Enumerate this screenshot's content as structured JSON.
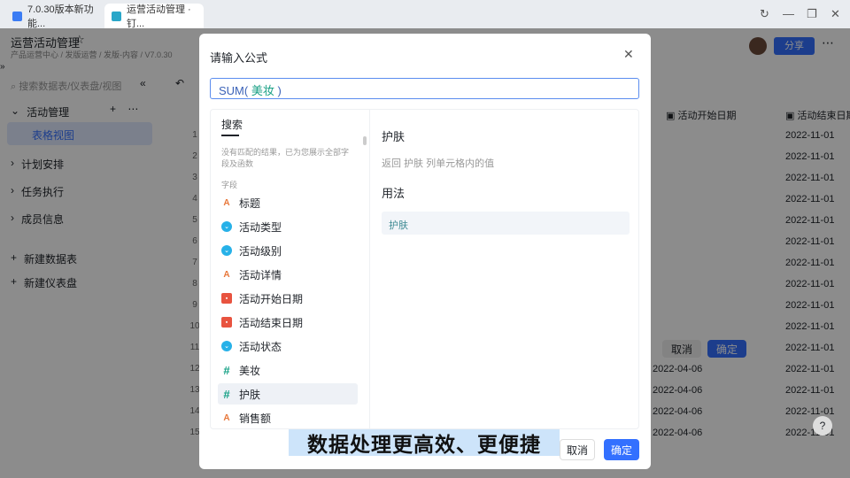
{
  "browser": {
    "tabs": [
      {
        "label": "7.0.30版本新功能..."
      },
      {
        "label": "运营活动管理 · 钉..."
      }
    ]
  },
  "header": {
    "title": "运营活动管理",
    "breadcrumb": "产品运营中心 / 发版运营 / 发版-内容 / V7.0.30",
    "share": "分享"
  },
  "sidebar": {
    "search_placeholder": "搜索数据表/仪表盘/视图",
    "items": [
      {
        "label": "活动管理"
      },
      {
        "label": "表格视图"
      },
      {
        "label": "计划安排"
      },
      {
        "label": "任务执行"
      },
      {
        "label": "成员信息"
      },
      {
        "label": "新建数据表"
      },
      {
        "label": "新建仪表盘"
      }
    ]
  },
  "table": {
    "columns": [
      "活动开始日期",
      "活动结束日期"
    ],
    "row_numbers": [
      "1",
      "2",
      "3",
      "4",
      "5",
      "6",
      "7",
      "8",
      "9",
      "10",
      "11",
      "12",
      "13",
      "14",
      "15"
    ],
    "start_dates": [
      "2022-04-06",
      "2022-04-06",
      "2022-04-06",
      "2022-04-06"
    ],
    "end_dates": [
      "2022-11-01",
      "2022-11-01",
      "2022-11-01",
      "2022-11-01",
      "2022-11-01",
      "2022-11-01",
      "2022-11-01",
      "2022-11-01",
      "2022-11-01",
      "2022-11-01",
      "2022-11-01",
      "2022-11-01",
      "2022-11-01",
      "2022-11-01",
      "2022-11-01"
    ],
    "inner_cancel": "取消",
    "inner_ok": "确定"
  },
  "modal": {
    "title": "请输入公式",
    "formula_fn": "SUM(",
    "formula_field": "美妆",
    "formula_end": ")",
    "search_tab": "搜索",
    "no_match": "没有匹配的结果，已为您展示全部字段及函数",
    "section": "字段",
    "fields": [
      {
        "label": "标题",
        "type": "text"
      },
      {
        "label": "活动类型",
        "type": "select"
      },
      {
        "label": "活动级别",
        "type": "select"
      },
      {
        "label": "活动详情",
        "type": "text"
      },
      {
        "label": "活动开始日期",
        "type": "date"
      },
      {
        "label": "活动结束日期",
        "type": "date"
      },
      {
        "label": "活动状态",
        "type": "select"
      },
      {
        "label": "美妆",
        "type": "number"
      },
      {
        "label": "护肤",
        "type": "number"
      },
      {
        "label": "销售额",
        "type": "text"
      }
    ],
    "detail_title": "护肤",
    "detail_desc": "返回 护肤 列单元格内的值",
    "usage_title": "用法",
    "usage_example": "护肤",
    "cancel": "取消",
    "ok": "确定"
  },
  "caption": "数据处理更高效、更便捷"
}
